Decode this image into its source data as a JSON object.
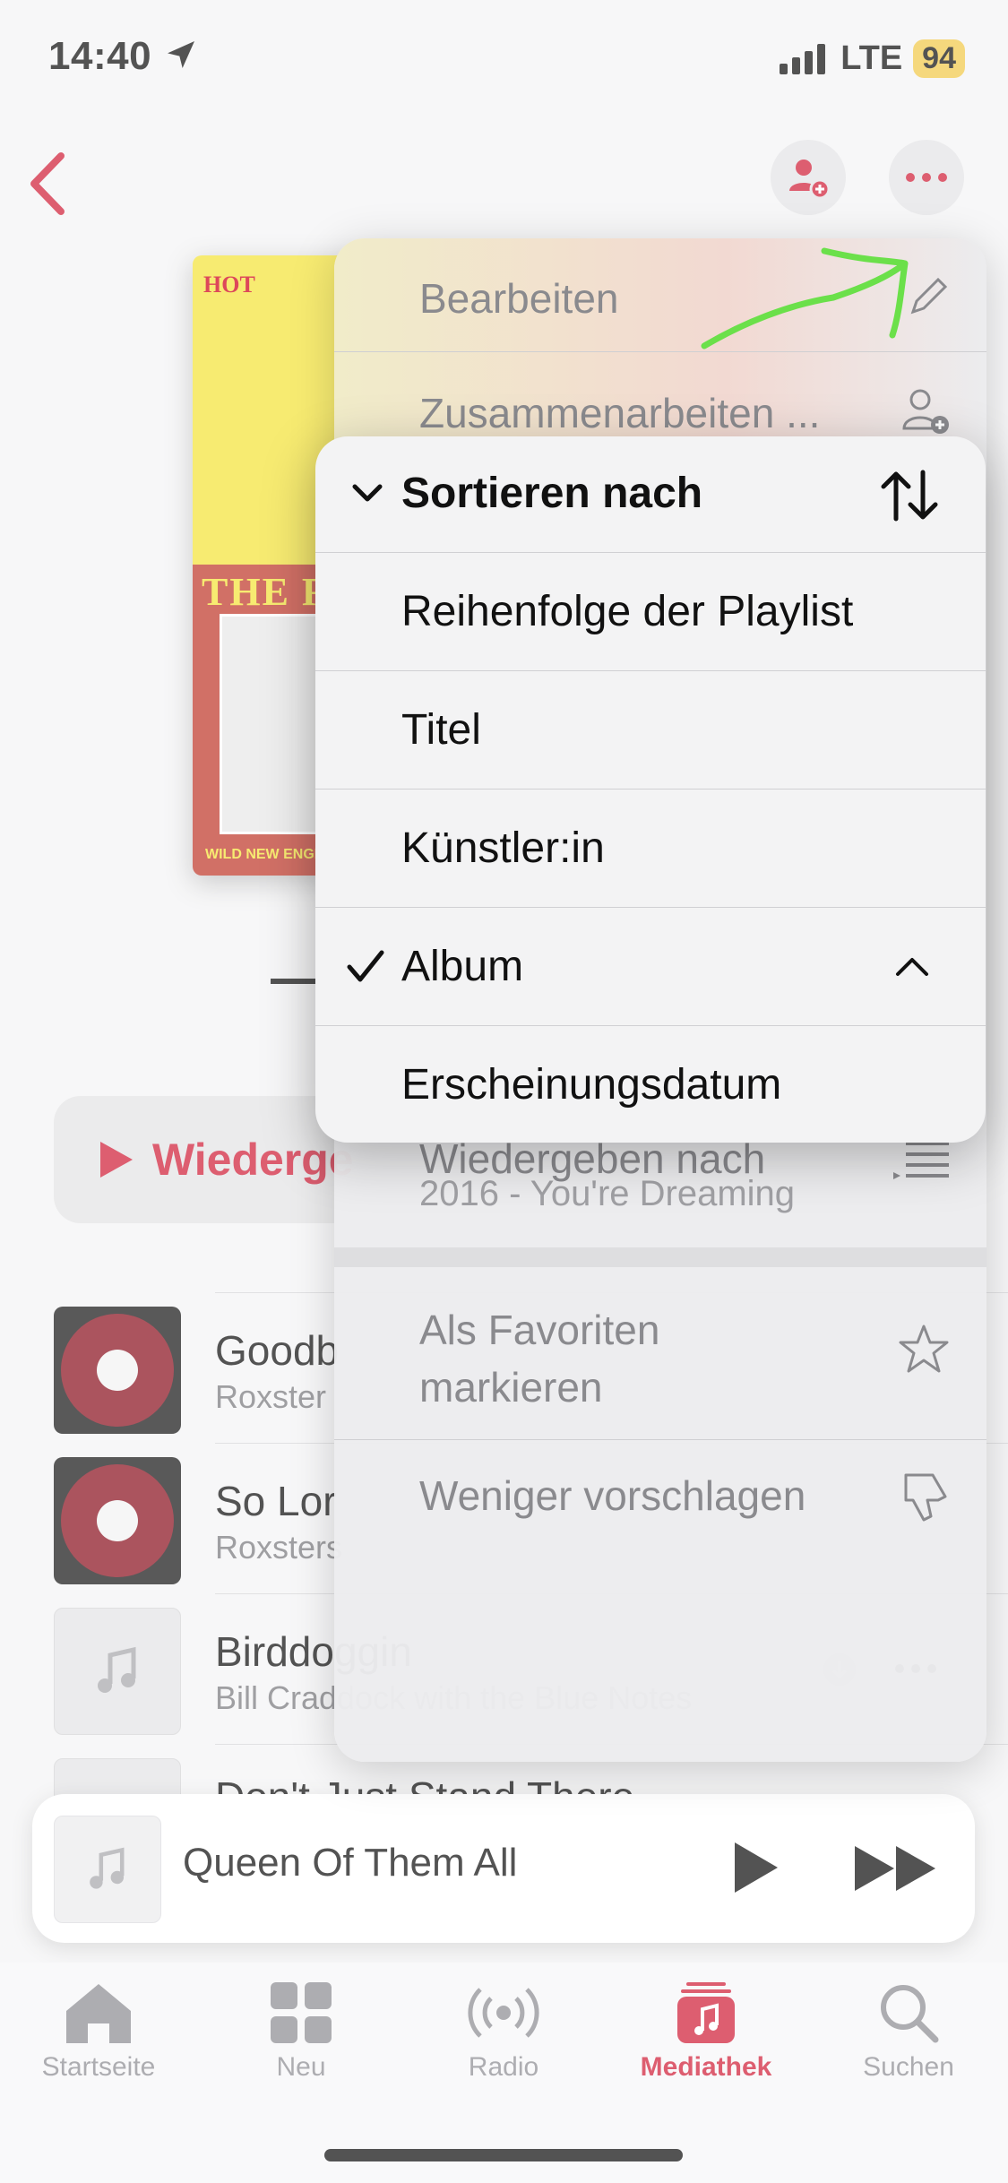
{
  "status_bar": {
    "time": "14:40",
    "network": "LTE",
    "battery": "94"
  },
  "playlist": {
    "play_button_label": "Wiederge",
    "cover_logo": "HOT",
    "cover_band": "THE RA",
    "cover_footer": "WILD NEW ENGLAND"
  },
  "songs": [
    {
      "title": "Goodb",
      "artist": "Roxster"
    },
    {
      "title": "So Lor",
      "artist": "Roxsters"
    },
    {
      "title": "Birddoggin",
      "artist": "Bill Craddock with the Blue Notes"
    },
    {
      "title": "Don't Just Stand There",
      "artist": ""
    }
  ],
  "context_menu": {
    "edit": "Bearbeiten",
    "collaborate": "Zusammenarbeiten ...",
    "play_next": "Wiedergeben nach",
    "play_next_sub": "2016 - You're Dreaming",
    "favorite": "Als Favoriten markieren",
    "favorite_line1": "Als Favoriten",
    "favorite_line2": "markieren",
    "suggest_less": "Weniger vorschlagen"
  },
  "sort_menu": {
    "header": "Sortieren nach",
    "options": [
      {
        "label": "Reihenfolge der Playlist",
        "selected": false
      },
      {
        "label": "Titel",
        "selected": false
      },
      {
        "label": "Künstler:in",
        "selected": false
      },
      {
        "label": "Album",
        "selected": true
      },
      {
        "label": "Erscheinungsdatum",
        "selected": false
      }
    ]
  },
  "mini_player": {
    "title": "Queen Of Them All"
  },
  "tab_bar": {
    "tabs": [
      {
        "label": "Startseite",
        "icon": "home-icon",
        "active": false
      },
      {
        "label": "Neu",
        "icon": "grid-icon",
        "active": false
      },
      {
        "label": "Radio",
        "icon": "radio-icon",
        "active": false
      },
      {
        "label": "Mediathek",
        "icon": "library-icon",
        "active": true
      },
      {
        "label": "Suchen",
        "icon": "search-icon",
        "active": false
      }
    ]
  },
  "colors": {
    "accent": "#d0213a",
    "annotation": "#6be04a"
  }
}
